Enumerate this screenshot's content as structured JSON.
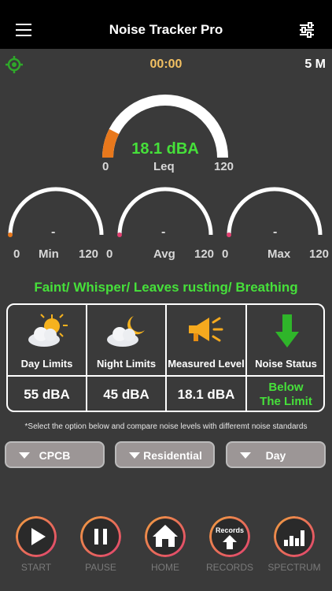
{
  "header": {
    "title": "Noise Tracker Pro",
    "menu_icon": "hamburger-menu-icon",
    "settings_icon": "sliders-icon"
  },
  "status": {
    "timer": "00:00",
    "duration": "5 M",
    "locate_icon": "crosshair-icon"
  },
  "leq_gauge": {
    "value": "18.1 dBA",
    "label": "Leq",
    "min": "0",
    "max": "120",
    "fill_fraction": 0.15,
    "fill_color": "#e8781c"
  },
  "small_gauges": [
    {
      "label": "Min",
      "value": "-",
      "min": "0",
      "max": "120"
    },
    {
      "label": "Avg",
      "value": "-",
      "min": "0",
      "max": "120"
    },
    {
      "label": "Max",
      "value": "-",
      "min": "0",
      "max": "120"
    }
  ],
  "category": "Faint/ Whisper/ Leaves rusting/ Breathing",
  "limits": {
    "day": {
      "label": "Day Limits",
      "value": "55 dBA",
      "icon": "sun-cloud-icon"
    },
    "night": {
      "label": "Night Limits",
      "value": "45 dBA",
      "icon": "moon-cloud-icon"
    },
    "measured": {
      "label": "Measured Level",
      "value": "18.1 dBA",
      "icon": "megaphone-icon"
    },
    "status": {
      "label": "Noise Status",
      "value_line1": "Below",
      "value_line2": "The Limit",
      "icon": "down-arrow-icon"
    }
  },
  "note": "*Select the option below and compare noise levels with differemt noise standards",
  "selectors": [
    {
      "value": "CPCB"
    },
    {
      "value": "Residential"
    },
    {
      "value": "Day"
    }
  ],
  "buttons": [
    {
      "label": "START",
      "icon": "play-icon"
    },
    {
      "label": "PAUSE",
      "icon": "pause-icon"
    },
    {
      "label": "HOME",
      "icon": "home-icon"
    },
    {
      "label": "RECORDS",
      "mini": "Records",
      "icon": "records-arrow-icon"
    },
    {
      "label": "SPECTRUM",
      "icon": "spectrum-bars-icon"
    }
  ],
  "colors": {
    "accent_green": "#46e03a",
    "timer": "#f2c062",
    "background": "#3a3a3a",
    "header": "#000000"
  }
}
